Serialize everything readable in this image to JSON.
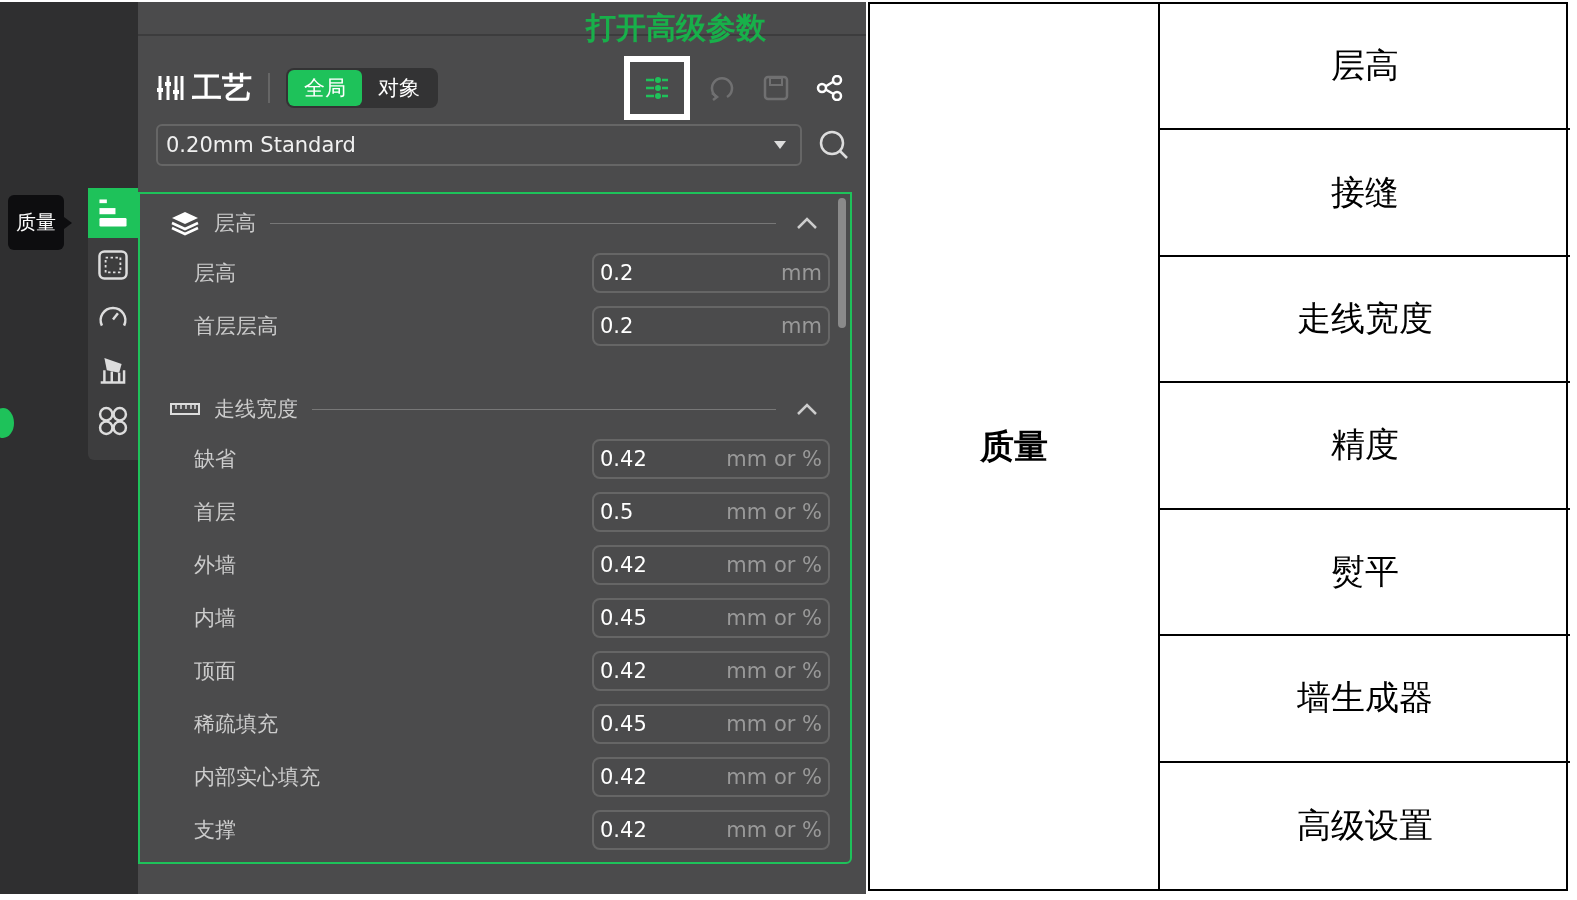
{
  "annotation": "打开高级参数",
  "header": {
    "title": "工艺",
    "scope_tabs": [
      {
        "label": "全局",
        "selected": true
      },
      {
        "label": "对象",
        "selected": false
      }
    ],
    "toolbar": [
      {
        "kind": "advanced",
        "highlighted": true,
        "disabled": false
      },
      {
        "kind": "undo",
        "highlighted": false,
        "disabled": true
      },
      {
        "kind": "save",
        "highlighted": false,
        "disabled": true
      },
      {
        "kind": "share",
        "highlighted": false,
        "disabled": false
      }
    ]
  },
  "preset": {
    "value": "0.20mm Standard"
  },
  "tooltip": "质量",
  "side_tabs": [
    {
      "kind": "quality",
      "selected": true
    },
    {
      "kind": "strength",
      "selected": false
    },
    {
      "kind": "speed",
      "selected": false
    },
    {
      "kind": "support",
      "selected": false
    },
    {
      "kind": "others",
      "selected": false
    }
  ],
  "sections": [
    {
      "kind": "layers",
      "title": "层高",
      "expanded": true,
      "rows": [
        {
          "label": "层高",
          "value": "0.2",
          "unit": "mm"
        },
        {
          "label": "首层层高",
          "value": "0.2",
          "unit": "mm"
        }
      ]
    },
    {
      "kind": "ruler",
      "title": "走线宽度",
      "expanded": true,
      "rows": [
        {
          "label": "缺省",
          "value": "0.42",
          "unit": "mm or %"
        },
        {
          "label": "首层",
          "value": "0.5",
          "unit": "mm or %"
        },
        {
          "label": "外墙",
          "value": "0.42",
          "unit": "mm or %"
        },
        {
          "label": "内墙",
          "value": "0.45",
          "unit": "mm or %"
        },
        {
          "label": "顶面",
          "value": "0.42",
          "unit": "mm or %"
        },
        {
          "label": "稀疏填充",
          "value": "0.45",
          "unit": "mm or %"
        },
        {
          "label": "内部实心填充",
          "value": "0.42",
          "unit": "mm or %"
        },
        {
          "label": "支撑",
          "value": "0.42",
          "unit": "mm or %"
        }
      ]
    }
  ],
  "table": {
    "category": "质量",
    "items": [
      "层高",
      "接缝",
      "走线宽度",
      "精度",
      "熨平",
      "墙生成器",
      "高级设置"
    ]
  }
}
